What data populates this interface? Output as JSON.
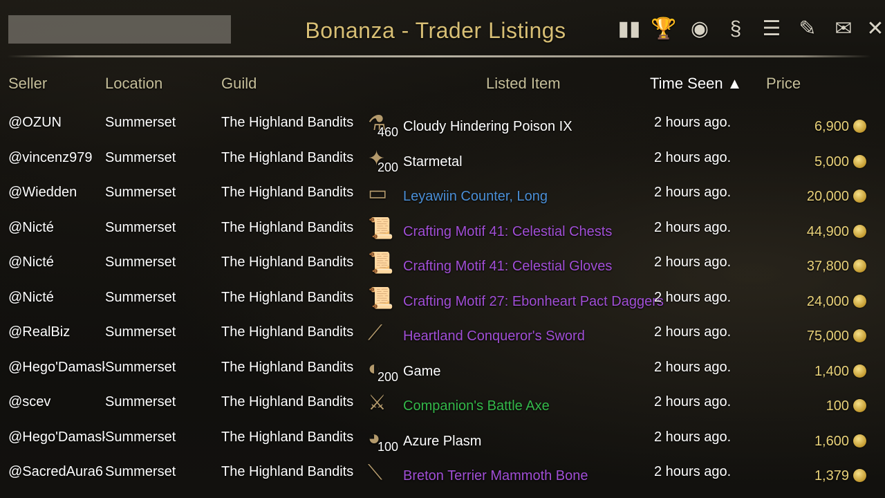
{
  "window": {
    "title": "Bonanza - Trader Listings"
  },
  "toolbar": {
    "icons": [
      {
        "name": "chart-icon",
        "glyph": "▮▮"
      },
      {
        "name": "trophy-icon",
        "glyph": "🏆"
      },
      {
        "name": "coins-icon",
        "glyph": "◉"
      },
      {
        "name": "craft-icon",
        "glyph": "§"
      },
      {
        "name": "list-icon",
        "glyph": "☰"
      },
      {
        "name": "quill-icon",
        "glyph": "✎"
      },
      {
        "name": "mail-icon",
        "glyph": "✉"
      },
      {
        "name": "close-icon",
        "glyph": "✕"
      }
    ]
  },
  "table": {
    "headers": {
      "seller": "Seller",
      "location": "Location",
      "guild": "Guild",
      "listed_item": "Listed Item",
      "time_seen": "Time Seen ▲",
      "price": "Price"
    },
    "rows": [
      {
        "seller": "@OZUN",
        "location": "Summerset",
        "guild": "The Highland Bandits",
        "item_icon": "poison-icon",
        "icon_glyph": "⚗",
        "qty": "460",
        "item": "Cloudy Hindering Poison IX",
        "quality": "white",
        "time": "2 hours ago.",
        "price": "6,900"
      },
      {
        "seller": "@vincenz979",
        "location": "Summerset",
        "guild": "The Highland Bandits",
        "item_icon": "metal-icon",
        "icon_glyph": "✦",
        "qty": "200",
        "item": "Starmetal",
        "quality": "white",
        "time": "2 hours ago.",
        "price": "5,000"
      },
      {
        "seller": "@Wiedden",
        "location": "Summerset",
        "guild": "The Highland Bandits",
        "item_icon": "furniture-icon",
        "icon_glyph": "▭",
        "qty": "",
        "item": "Leyawiin Counter, Long",
        "quality": "blue",
        "time": "2 hours ago.",
        "price": "20,000"
      },
      {
        "seller": "@Nicté",
        "location": "Summerset",
        "guild": "The Highland Bandits",
        "item_icon": "motif-icon",
        "icon_glyph": "📜",
        "qty": "",
        "item": "Crafting Motif 41: Celestial Chests",
        "quality": "purple",
        "time": "2 hours ago.",
        "price": "44,900"
      },
      {
        "seller": "@Nicté",
        "location": "Summerset",
        "guild": "The Highland Bandits",
        "item_icon": "motif-icon",
        "icon_glyph": "📜",
        "qty": "",
        "item": "Crafting Motif 41: Celestial Gloves",
        "quality": "purple",
        "time": "2 hours ago.",
        "price": "37,800"
      },
      {
        "seller": "@Nicté",
        "location": "Summerset",
        "guild": "The Highland Bandits",
        "item_icon": "motif-icon",
        "icon_glyph": "📜",
        "qty": "",
        "item": "Crafting Motif 27: Ebonheart Pact Daggers",
        "quality": "purple",
        "time": "2 hours ago.",
        "price": "24,000"
      },
      {
        "seller": "@RealBiz",
        "location": "Summerset",
        "guild": "The Highland Bandits",
        "item_icon": "sword-icon",
        "icon_glyph": "⟋",
        "qty": "",
        "item": "Heartland Conqueror's Sword",
        "quality": "purple",
        "time": "2 hours ago.",
        "price": "75,000"
      },
      {
        "seller": "@Hego'Damask",
        "location": "Summerset",
        "guild": "The Highland Bandits",
        "item_icon": "meat-icon",
        "icon_glyph": "◐",
        "qty": "200",
        "item": "Game",
        "quality": "white",
        "time": "2 hours ago.",
        "price": "1,400"
      },
      {
        "seller": "@scev",
        "location": "Summerset",
        "guild": "The Highland Bandits",
        "item_icon": "axe-icon",
        "icon_glyph": "⚔",
        "qty": "",
        "item": "Companion's Battle Axe",
        "quality": "green",
        "time": "2 hours ago.",
        "price": "100"
      },
      {
        "seller": "@Hego'Damask",
        "location": "Summerset",
        "guild": "The Highland Bandits",
        "item_icon": "plasm-icon",
        "icon_glyph": "◕",
        "qty": "100",
        "item": "Azure Plasm",
        "quality": "white",
        "time": "2 hours ago.",
        "price": "1,600"
      },
      {
        "seller": "@SacredAura6",
        "location": "Summerset",
        "guild": "The Highland Bandits",
        "item_icon": "bone-icon",
        "icon_glyph": "⟍",
        "qty": "",
        "item": "Breton Terrier Mammoth Bone",
        "quality": "purple",
        "time": "2 hours ago.",
        "price": "1,379"
      }
    ]
  },
  "colors": {
    "title": "#d8bf75",
    "header": "#c6bf9a",
    "price": "#e9d27a",
    "quality_white": "#ffffff",
    "quality_blue": "#4b8fd6",
    "quality_purple": "#a14fd6",
    "quality_green": "#34b84a"
  }
}
